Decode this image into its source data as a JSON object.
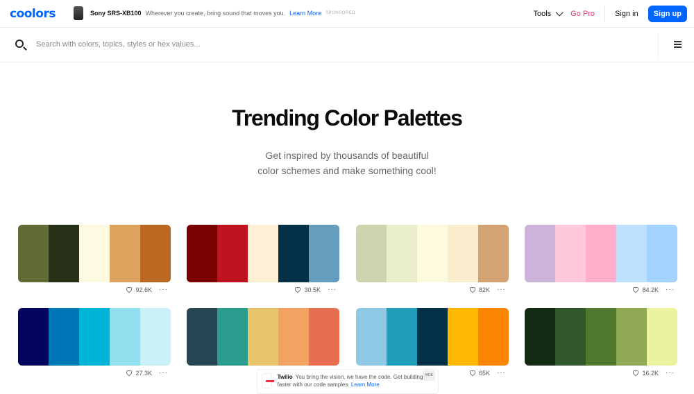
{
  "header": {
    "logo": "coolors",
    "ad": {
      "title": "Sony SRS-XB100",
      "text": "Wherever you create, bring sound that moves you.",
      "link": "Learn More",
      "sponsored": "SPONSORED"
    },
    "tools_label": "Tools",
    "go_pro_label": "Go Pro",
    "sign_in_label": "Sign in",
    "sign_up_label": "Sign up"
  },
  "search": {
    "placeholder": "Search with colors, topics, styles or hex values..."
  },
  "hero": {
    "title": "Trending Color Palettes",
    "subtitle_line1": "Get inspired by thousands of beautiful",
    "subtitle_line2": "color schemes and make something cool!"
  },
  "palettes": [
    {
      "colors": [
        "#606b35",
        "#263117",
        "#fefae1",
        "#dca45f",
        "#bb6823"
      ],
      "likes": "92.6K"
    },
    {
      "colors": [
        "#7b0101",
        "#c1121f",
        "#fdf0d5",
        "#023047",
        "#669cbd"
      ],
      "likes": "30.5K"
    },
    {
      "colors": [
        "#ccd5ae",
        "#e9edc9",
        "#fefae0",
        "#faedcd",
        "#d4a373"
      ],
      "likes": "82K"
    },
    {
      "colors": [
        "#cdb4db",
        "#ffc8dd",
        "#ffafcc",
        "#bde0fe",
        "#a2d2ff"
      ],
      "likes": "84.2K"
    },
    {
      "colors": [
        "#03045e",
        "#0077b6",
        "#00b4d8",
        "#90e0ef",
        "#caf0f8"
      ],
      "likes": "27.3K"
    },
    {
      "colors": [
        "#264653",
        "#2a9d8f",
        "#e9c46a",
        "#f4a261",
        "#e76f51"
      ],
      "likes": ""
    },
    {
      "colors": [
        "#8ecae6",
        "#219ebc",
        "#023047",
        "#ffb703",
        "#fb8500"
      ],
      "likes": "65K"
    },
    {
      "colors": [
        "#132a13",
        "#31572c",
        "#4f772d",
        "#90a955",
        "#ecf39e"
      ],
      "likes": "16.2K"
    }
  ],
  "bottom_ad": {
    "brand": "Twilio",
    "text": "You bring the vision, we have the code. Get building faster with our code samples.",
    "link": "Learn More",
    "hide": "HIDE"
  }
}
